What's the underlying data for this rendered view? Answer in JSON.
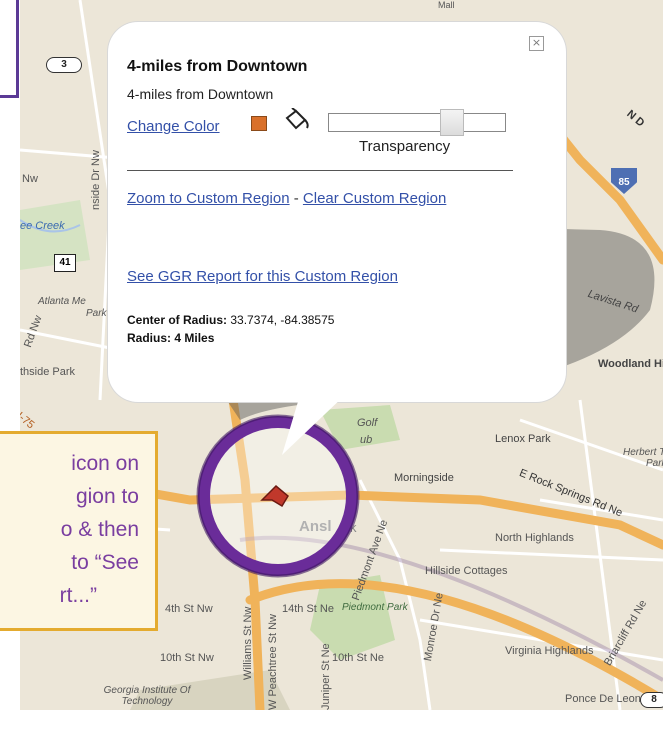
{
  "popup": {
    "close_label": "×",
    "title": "4-miles from Downtown",
    "subtitle": "4-miles from Downtown",
    "change_color_label": "Change Color",
    "swatch_color": "#d9702a",
    "transparency_label": "Transparency",
    "transparency_value": 0.7,
    "zoom_link": "Zoom to Custom Region",
    "separator": " - ",
    "clear_link": "Clear Custom Region",
    "report_link": "See GGR Report for this Custom Region",
    "center_label": "Center of Radius:",
    "center_value": "33.7374, -84.38575",
    "radius_label": "Radius:",
    "radius_value": "4 Miles"
  },
  "callout": {
    "lines": [
      "icon on",
      "gion to",
      "o & then",
      "to “See",
      "rt...”"
    ],
    "text_color": "#7a3ea0",
    "border_color": "#e4ab2f"
  },
  "map": {
    "labels": {
      "mall": "Mall",
      "ee_creek": "ee Creek",
      "nside_dr": "nside Dr Nw",
      "nw": "Nw",
      "atlanta_me": "Atlanta Me",
      "park": "Park",
      "rd_nw": "Rd Nw",
      "nw2": "Nw",
      "thside_park": "thside Park",
      "i75": "I-75",
      "nd": "N D",
      "lavista": "Lavista Rd",
      "woodland": "Woodland Hi",
      "golf": "Golf",
      "club": "ub",
      "lenox_park": "Lenox Park",
      "herbert": "Herbert T",
      "herbert_park": "Park",
      "morningside": "Morningside",
      "east_rock": "E Rock Springs Rd Ne",
      "ansley": "Ansl",
      "ansley_k": "k",
      "piedmont_ave": "Piedmont Ave Ne",
      "north_highlands": "North Highlands",
      "hillside": "Hillside Cottages",
      "williams": "Williams St Nw",
      "w_peachtree": "W Peachtree St Nw",
      "st14_w": "4th St Nw",
      "st14_ne": "14th St Ne",
      "piedmont_park": "Piedmont Park",
      "monroe": "Monroe Dr Ne",
      "juniper": "Juniper St Ne",
      "st10_w": "10th St Nw",
      "st10_ne": "10th St Ne",
      "virginia": "Virginia Highlands",
      "briarcliff": "Briarcliff Rd Ne",
      "georgia_tech": "Georgia Institute Of Technology",
      "ponce": "Ponce De Leon Ave Ne",
      "shield_3": "3",
      "shield_41": "41",
      "shield_85": "85",
      "shield_8": "8"
    },
    "colors": {
      "land": "#ece6d8",
      "highway": "#f0b35a",
      "road": "#ffffff",
      "park": "#c9dcb0",
      "water": "#a9c4e8",
      "marker_ring": "#6a2c99"
    }
  }
}
